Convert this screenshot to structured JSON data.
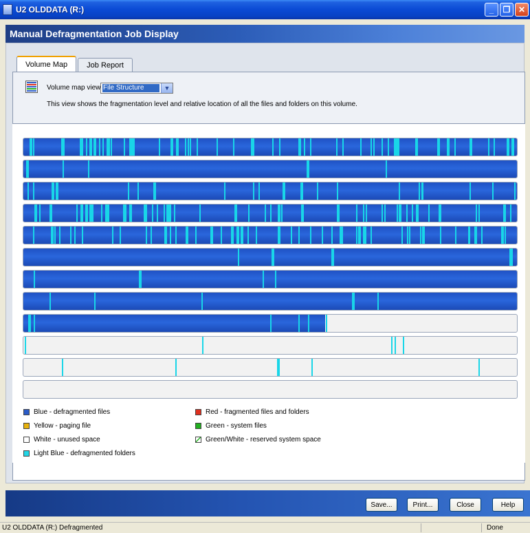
{
  "window": {
    "title": "U2 OLDDATA (R:)"
  },
  "header": {
    "title": "Manual Defragmentation Job Display"
  },
  "tabs": [
    {
      "label": "Volume Map",
      "active": true
    },
    {
      "label": "Job Report",
      "active": false
    }
  ],
  "view": {
    "label": "Volume map view:",
    "selected": "File Structure",
    "description": "This view shows the fragmentation level and relative location of all the files and folders on this volume."
  },
  "legend": [
    {
      "label": "Blue - defragmented files",
      "color": "#2A5BC8"
    },
    {
      "label": "Yellow - paging file",
      "color": "#E8B20C"
    },
    {
      "label": "White - unused space",
      "color": "#FFFFFF"
    },
    {
      "label": "Light Blue - defragmented folders",
      "color": "#22D6E6"
    },
    {
      "label": "Red - fragmented files and folders",
      "color": "#E0301E"
    },
    {
      "label": "Green - system files",
      "color": "#22B020"
    },
    {
      "label": "Green/White - reserved system space",
      "color": "#FFFFFF"
    }
  ],
  "buttons": {
    "save": "Save...",
    "print": "Print...",
    "close": "Close",
    "help": "Help"
  },
  "status": {
    "text": "U2 OLDDATA (R:) Defragmented",
    "done": "Done"
  },
  "colors": {
    "defragmented": "#2A5BC8",
    "folder": "#22D6E6",
    "unused": "#F2F2F2"
  },
  "volume_map": [
    {
      "blue_fraction": 1.0,
      "folder_density": "high"
    },
    {
      "blue_fraction": 1.0,
      "folder_density": "low"
    },
    {
      "blue_fraction": 1.0,
      "folder_density": "medium"
    },
    {
      "blue_fraction": 1.0,
      "folder_density": "high"
    },
    {
      "blue_fraction": 1.0,
      "folder_density": "high"
    },
    {
      "blue_fraction": 1.0,
      "folder_density": "low"
    },
    {
      "blue_fraction": 1.0,
      "folder_density": "low"
    },
    {
      "blue_fraction": 1.0,
      "folder_density": "low"
    },
    {
      "blue_fraction": 0.61,
      "folder_density": "low"
    },
    {
      "blue_fraction": 0.0,
      "folder_density": "low"
    },
    {
      "blue_fraction": 0.0,
      "folder_density": "low"
    },
    {
      "blue_fraction": 0.0,
      "folder_density": "none"
    }
  ]
}
